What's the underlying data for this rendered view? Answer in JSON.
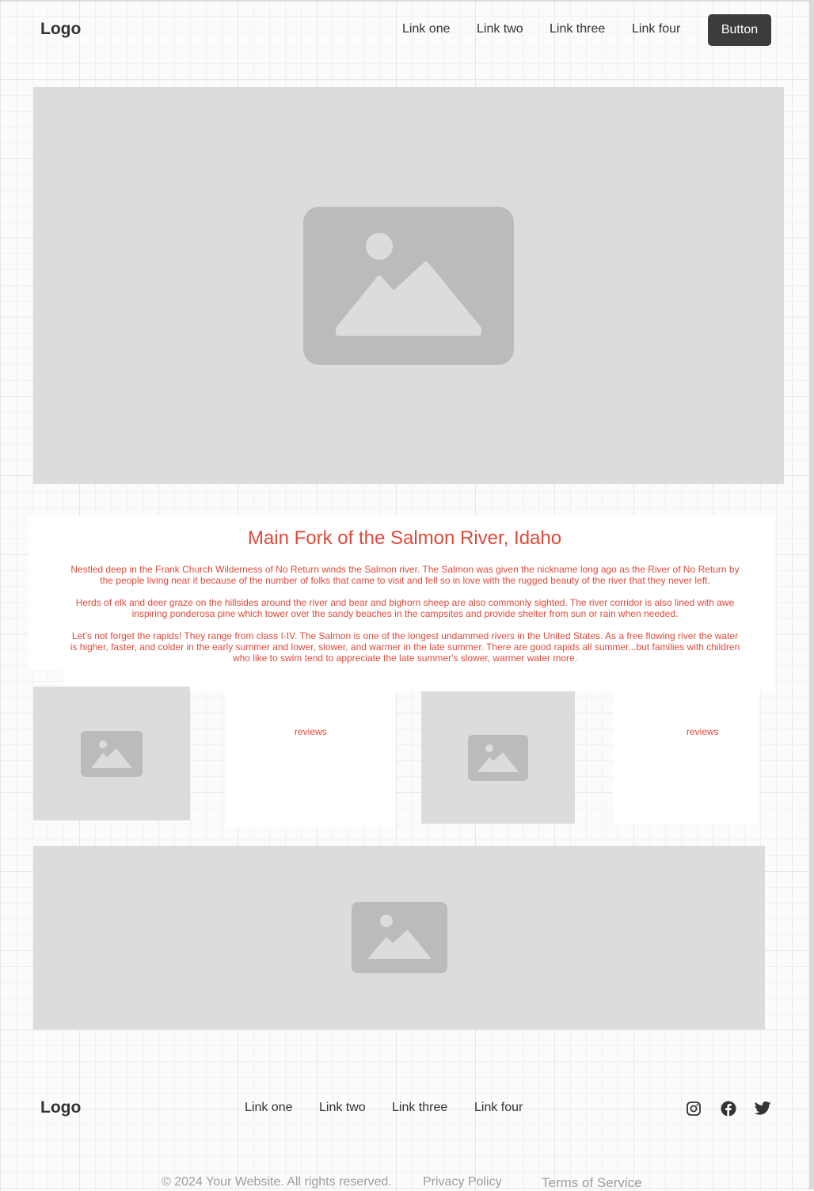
{
  "header": {
    "logo": "Logo",
    "nav": [
      "Link one",
      "Link two",
      "Link three",
      "Link four"
    ],
    "button": "Button"
  },
  "article": {
    "title": "Main Fork of the Salmon River, Idaho",
    "paragraphs": [
      "Nestled deep in the Frank Church Wilderness of No Return winds the Salmon river. The Salmon was given the nickname long ago as the River of No Return by the people living near it because of the number of folks that came to visit and fell so in love with the rugged beauty of the river that they never left.",
      "Herds of elk and deer graze on the hillsides around the river and bear and bighorn sheep are also commonly sighted. The river corridor is also lined with awe inspiring ponderosa pine which tower over the sandy beaches in the campsites and provide shelter from sun or rain when needed.",
      "Let's not forget the rapids! They range from class I-IV. The Salmon is one of the longest undammed rivers in the United States. As a free flowing river the water is higher, faster, and colder in the early summer and lower, slower, and warmer in the late summer. There are good rapids all summer...but families with children who like to swim tend to appreciate the late summer's slower, warmer water more."
    ]
  },
  "cards": [
    {
      "reviews": "reviews"
    },
    {
      "reviews": "reviews"
    }
  ],
  "footer": {
    "logo": "Logo",
    "nav": [
      "Link one",
      "Link two",
      "Link three",
      "Link four"
    ],
    "social_icons": [
      "instagram-icon",
      "facebook-icon",
      "twitter-icon"
    ],
    "copyright": "© 2024 Your Website. All rights reserved.",
    "privacy": "Privacy Policy",
    "terms": "Terms of Service"
  },
  "colors": {
    "accent": "#e04a3a",
    "button_bg": "#3c3c3c",
    "placeholder_bg": "#dcdcdc",
    "placeholder_icon": "#bbbbbb"
  }
}
